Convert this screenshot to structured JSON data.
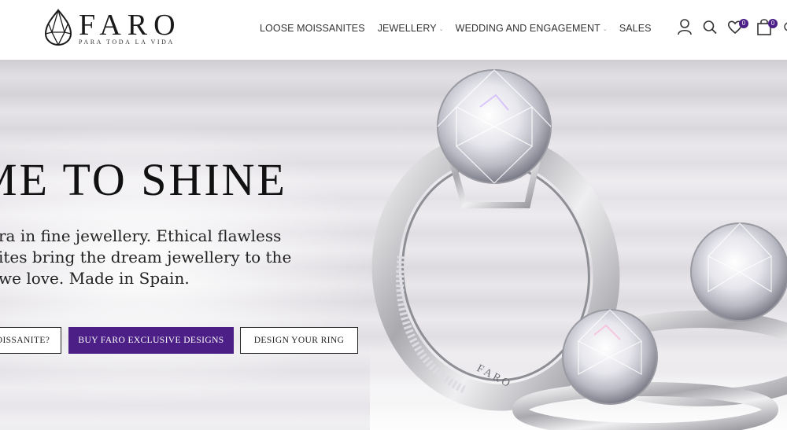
{
  "brand": {
    "name": "FARO",
    "tagline": "PARA TODA LA VIDA"
  },
  "nav": {
    "items": [
      {
        "label": "LOOSE MOISSANITES",
        "has_dropdown": false
      },
      {
        "label": "JEWELLERY",
        "has_dropdown": true
      },
      {
        "label": "WEDDING AND ENGAGEMENT",
        "has_dropdown": true
      },
      {
        "label": "SALES",
        "has_dropdown": false
      }
    ],
    "chevron": "⌄"
  },
  "header_icons": {
    "account": "user-icon",
    "search": "search-icon",
    "wishlist": "heart-icon",
    "wishlist_count": "0",
    "cart": "shopping-bag-icon",
    "cart_count": "0"
  },
  "hero": {
    "title": "ME TO SHINE",
    "text_lines": [
      "ra in fine jewellery. Ethical flawless",
      "ites bring the dream jewellery to the",
      "we love. Made in Spain."
    ],
    "buttons": {
      "what_is": "OISSANITE?",
      "buy": "BUY FARO EXCLUSIVE DESIGNS",
      "design": "DESIGN YOUR RING"
    },
    "ring_engraving": "FARO"
  },
  "colors": {
    "accent": "#4b1f86",
    "text": "#222222",
    "hero_bg": "#e2dfe4"
  }
}
